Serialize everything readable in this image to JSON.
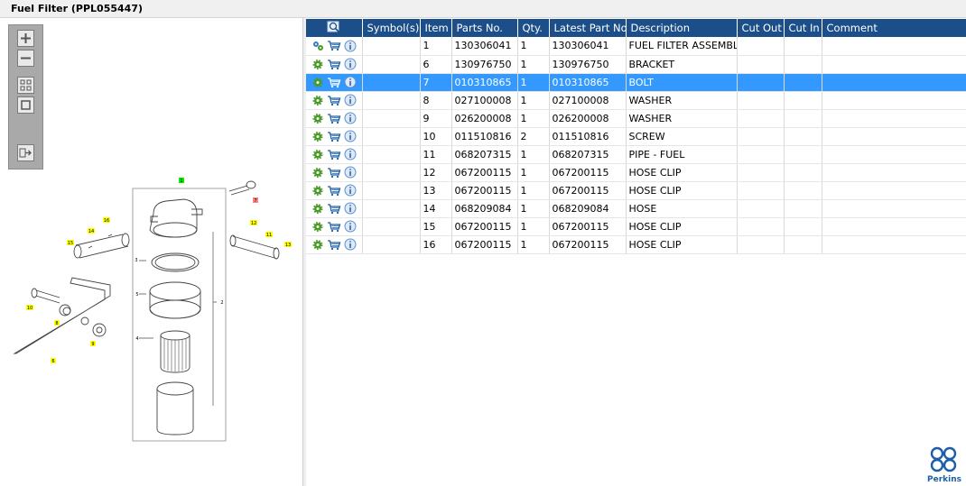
{
  "window": {
    "title": "Fuel Filter (PPL055447)"
  },
  "grid": {
    "columns": [
      "",
      "Symbol(s)",
      "Item",
      "Parts No.",
      "Qty.",
      "Latest Part No.",
      "Description",
      "Cut Out",
      "Cut In",
      "Comment"
    ],
    "rows": [
      {
        "item": "1",
        "part_no": "130306041",
        "qty": "1",
        "latest": "130306041",
        "desc": "FUEL FILTER ASSEMBLY",
        "selected": false
      },
      {
        "item": "6",
        "part_no": "130976750",
        "qty": "1",
        "latest": "130976750",
        "desc": "BRACKET",
        "selected": false
      },
      {
        "item": "7",
        "part_no": "010310865",
        "qty": "1",
        "latest": "010310865",
        "desc": "BOLT",
        "selected": true
      },
      {
        "item": "8",
        "part_no": "027100008",
        "qty": "1",
        "latest": "027100008",
        "desc": "WASHER",
        "selected": false
      },
      {
        "item": "9",
        "part_no": "026200008",
        "qty": "1",
        "latest": "026200008",
        "desc": "WASHER",
        "selected": false
      },
      {
        "item": "10",
        "part_no": "011510816",
        "qty": "2",
        "latest": "011510816",
        "desc": "SCREW",
        "selected": false
      },
      {
        "item": "11",
        "part_no": "068207315",
        "qty": "1",
        "latest": "068207315",
        "desc": "PIPE - FUEL",
        "selected": false
      },
      {
        "item": "12",
        "part_no": "067200115",
        "qty": "1",
        "latest": "067200115",
        "desc": "HOSE CLIP",
        "selected": false
      },
      {
        "item": "13",
        "part_no": "067200115",
        "qty": "1",
        "latest": "067200115",
        "desc": "HOSE CLIP",
        "selected": false
      },
      {
        "item": "14",
        "part_no": "068209084",
        "qty": "1",
        "latest": "068209084",
        "desc": "HOSE",
        "selected": false
      },
      {
        "item": "15",
        "part_no": "067200115",
        "qty": "1",
        "latest": "067200115",
        "desc": "HOSE CLIP",
        "selected": false
      },
      {
        "item": "16",
        "part_no": "067200115",
        "qty": "1",
        "latest": "067200115",
        "desc": "HOSE CLIP",
        "selected": false
      }
    ]
  },
  "toolbar": {
    "buttons": [
      "zoom-in-icon",
      "zoom-out-icon",
      "fit-all-icon",
      "fit-window-icon",
      "export-icon"
    ]
  },
  "diagram": {
    "callouts": [
      "1",
      "2",
      "3",
      "4",
      "5",
      "6",
      "7",
      "8",
      "9",
      "10",
      "11",
      "12",
      "13",
      "14",
      "15",
      "16"
    ]
  },
  "logo": {
    "text": "Perkins"
  },
  "colors": {
    "header": "#1c4e8a",
    "selection": "#3399ff",
    "callout": "#ffff00",
    "callout_red": "#ff8080",
    "callout_green": "#00ee00"
  }
}
